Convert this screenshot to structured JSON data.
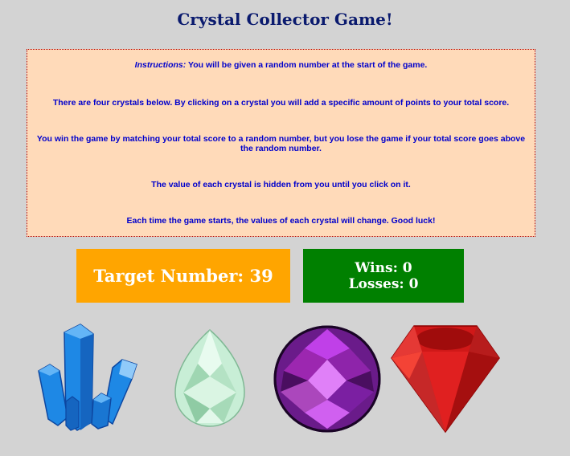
{
  "page": {
    "title": "Crystal Collector Game!"
  },
  "instructions": {
    "intro_label": "Instructions:",
    "intro_text": " You will be given a random number at the start of the game.",
    "line2": "There are four crystals below. By clicking on a crystal you will add a specific amount of points to your total score.",
    "line3": "You win the game by matching your total score to a random number, but you lose the game if your total score goes above the random number.",
    "line4": "The value of each crystal is hidden from you until you click on it.",
    "line5": "Each time the game starts, the values of each crystal will change. Good luck!"
  },
  "target": {
    "label": "Target Number: 39"
  },
  "score": {
    "wins": "Wins: 0",
    "losses": "Losses: 0"
  },
  "crystals": [
    {
      "icon": "blue-crystal-cluster-icon",
      "color": "#1e7be0"
    },
    {
      "icon": "green-teardrop-gem-icon",
      "color": "#b8e6c8"
    },
    {
      "icon": "purple-round-gem-icon",
      "color": "#9b30c8"
    },
    {
      "icon": "red-ruby-gem-icon",
      "color": "#cc1010"
    }
  ],
  "colors": {
    "background": "#d3d3d3",
    "title": "#0a1a6e",
    "instructions_bg": "#ffdab9",
    "instructions_text": "#0000cc",
    "target_bg": "#ffa500",
    "score_bg": "#008000"
  }
}
